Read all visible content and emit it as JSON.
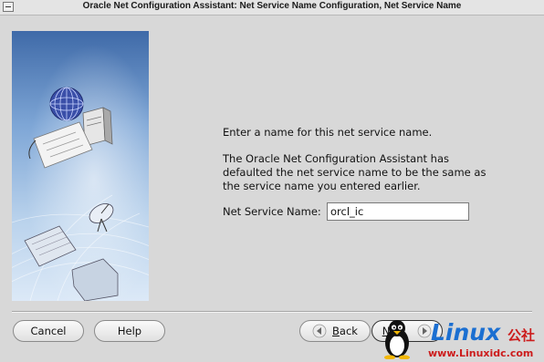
{
  "window": {
    "title": "Oracle Net Configuration Assistant: Net Service Name Configuration, Net Service Name"
  },
  "main": {
    "instruction": "Enter a name for this net service name.",
    "description": "The Oracle Net Configuration Assistant has defaulted the net service name to be the same as the service name you entered earlier.",
    "field_label": "Net Service Name:",
    "field_value": "orcl_ic"
  },
  "buttons": {
    "cancel": "Cancel",
    "help": "Help",
    "back_mnemonic": "B",
    "back_rest": "ack",
    "next_visible": "N"
  },
  "watermark": {
    "brand": "Linux",
    "suffix": "公社",
    "url": "www.Linuxidc.com"
  },
  "colors": {
    "panel_top": "#3f6aa8",
    "panel_bottom": "#d7e6f6",
    "watermark_blue": "#1b6fd1",
    "watermark_red": "#cc1c1c"
  }
}
